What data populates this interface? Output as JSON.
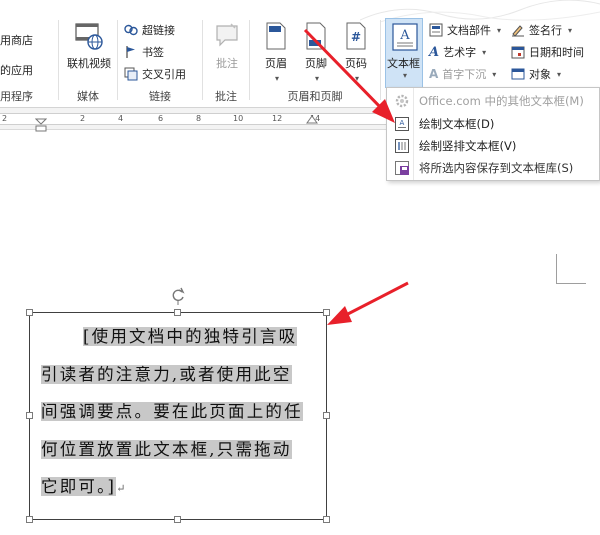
{
  "ribbon": {
    "app_group": {
      "item1": "用商店",
      "item2": "的应用",
      "label": "用程序"
    },
    "media": {
      "online_video": "联机视频",
      "label": "媒体"
    },
    "links": {
      "hyperlink": "超链接",
      "bookmark": "书签",
      "cross_ref": "交叉引用",
      "label": "链接"
    },
    "comments": {
      "comment": "批注",
      "label": "批注"
    },
    "header_footer": {
      "header": "页眉",
      "footer": "页脚",
      "page_number": "页码",
      "label": "页眉和页脚"
    },
    "text": {
      "textbox": "文本框",
      "doc_parts": "文档部件",
      "wordart": "艺术字",
      "dropcap": "首字下沉",
      "signature": "签名行",
      "datetime": "日期和时间",
      "object": "对象"
    }
  },
  "ruler": {
    "ticks": [
      "2",
      "2",
      "4",
      "6",
      "8",
      "10",
      "12",
      "14"
    ]
  },
  "menu": {
    "items": [
      {
        "label": "Office.com 中的其他文本框(M)",
        "disabled": true
      },
      {
        "label": "绘制文本框(D)"
      },
      {
        "label": "绘制竖排文本框(V)"
      },
      {
        "label": "将所选内容保存到文本框库(S)",
        "disabled": true
      }
    ]
  },
  "textbox": {
    "lines": [
      "[使用文档中的独特引言吸",
      "引读者的注意力,或者使用此空",
      "间强调要点。要在此页面上的任",
      "何位置放置此文本框,只需拖动",
      "它即可。]"
    ],
    "pilcrow": "↵"
  },
  "colors": {
    "accent_blue": "#2b579a",
    "arrow_red": "#e8202a",
    "selection": "#c8c8c8"
  }
}
